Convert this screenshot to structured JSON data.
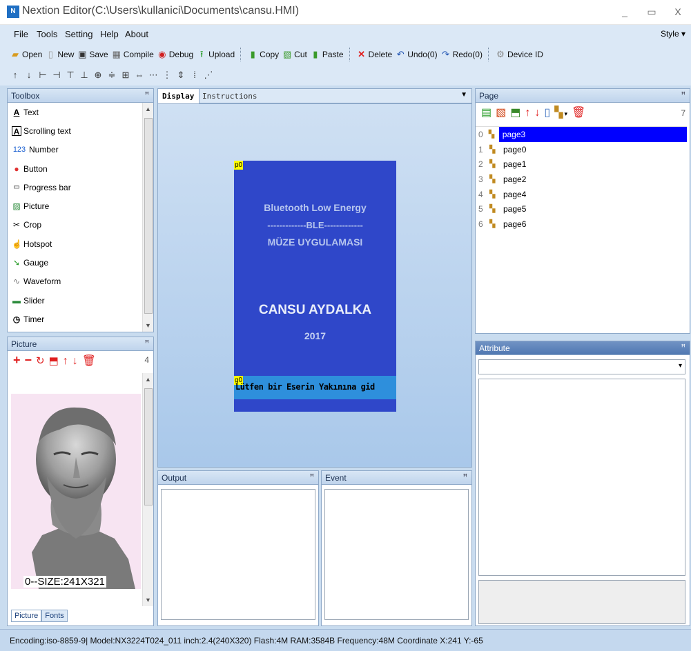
{
  "window": {
    "title": "Nextion Editor(C:\\Users\\kullanici\\Documents\\cansu.HMI)",
    "app_icon": "N",
    "minimize": "_",
    "maximize": "▭",
    "close": "X"
  },
  "menu": {
    "items": [
      "File",
      "Tools",
      "Setting",
      "Help",
      "About"
    ],
    "style": "Style ▾"
  },
  "toolbar": {
    "open": "Open",
    "new": "New",
    "save": "Save",
    "compile": "Compile",
    "debug": "Debug",
    "upload": "Upload",
    "copy": "Copy",
    "cut": "Cut",
    "paste": "Paste",
    "delete": "Delete",
    "undo": "Undo(0)",
    "redo": "Redo(0)",
    "device_id": "Device ID"
  },
  "toolbox": {
    "title": "Toolbox",
    "items": [
      {
        "label": "Text",
        "icon": "text-icon"
      },
      {
        "label": "Scrolling text",
        "icon": "scrolling-text-icon"
      },
      {
        "label": "Number",
        "icon": "number-icon"
      },
      {
        "label": "Button",
        "icon": "button-icon"
      },
      {
        "label": "Progress bar",
        "icon": "progress-bar-icon"
      },
      {
        "label": "Picture",
        "icon": "picture-icon"
      },
      {
        "label": "Crop",
        "icon": "crop-icon"
      },
      {
        "label": "Hotspot",
        "icon": "hotspot-icon"
      },
      {
        "label": "Gauge",
        "icon": "gauge-icon"
      },
      {
        "label": "Waveform",
        "icon": "waveform-icon"
      },
      {
        "label": "Slider",
        "icon": "slider-icon"
      },
      {
        "label": "Timer",
        "icon": "timer-icon"
      }
    ]
  },
  "picture_panel": {
    "title": "Picture",
    "count": "4",
    "size_label": "0--SIZE:241X321",
    "tabs": [
      "Picture",
      "Fonts"
    ]
  },
  "display": {
    "tabs": [
      "Display",
      "Instructions"
    ],
    "canvas": {
      "p0_tag": "p0",
      "g0_tag": "g0",
      "line1": "Bluetooth Low Energy",
      "line2": "-------------BLE-------------",
      "line3": "MÜZE UYGULAMASI",
      "name": "CANSU AYDALKA",
      "year": "2017",
      "scroll_text": "Lütfen bir Eserin Yakınına gid",
      "bg_color": "#2f47c9",
      "scroll_bg": "#2e8fdc"
    }
  },
  "page_panel": {
    "title": "Page",
    "count": "7",
    "pages": [
      {
        "index": "0",
        "name": "page3",
        "selected": true
      },
      {
        "index": "1",
        "name": "page0"
      },
      {
        "index": "2",
        "name": "page1"
      },
      {
        "index": "3",
        "name": "page2"
      },
      {
        "index": "4",
        "name": "page4"
      },
      {
        "index": "5",
        "name": "page5"
      },
      {
        "index": "6",
        "name": "page6"
      }
    ]
  },
  "attribute_panel": {
    "title": "Attribute"
  },
  "output_panel": {
    "title": "Output"
  },
  "event_panel": {
    "title": "Event"
  },
  "status": {
    "text": "Encoding:iso-8859-9| Model:NX3224T024_011  inch:2.4(240X320) Flash:4M RAM:3584B Frequency:48M    Coordinate X:241  Y:-65"
  }
}
